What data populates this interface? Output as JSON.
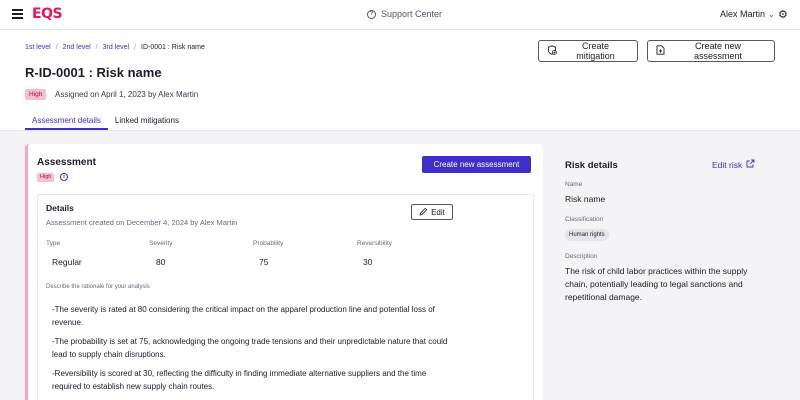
{
  "app": {
    "logo": "EQS",
    "support": "Support Center",
    "user": "Alex Martin"
  },
  "breadcrumb": [
    "1st level",
    "2nd level",
    "3rd level",
    "ID-0001 : Risk name"
  ],
  "header": {
    "title": "R-ID-0001 : Risk name",
    "badge": "High",
    "assigned": "Assigned on April 1, 2023 by Alex Martin",
    "create_mitigation": "Create mitigation",
    "create_new_assessment": "Create new assessment"
  },
  "tabs": [
    {
      "label": "Assessment details",
      "active": true
    },
    {
      "label": "Linked mitigations",
      "active": false
    }
  ],
  "assessment": {
    "title": "Assessment",
    "badge": "High",
    "button": "Create new assessment",
    "details": {
      "title": "Details",
      "meta": "Assessment created on December 4, 2024 by Alex Martin",
      "edit": "Edit",
      "fields": [
        {
          "label": "Type",
          "value": "Regular"
        },
        {
          "label": "Severity",
          "value": "80"
        },
        {
          "label": "Probability",
          "value": "75"
        },
        {
          "label": "Reversibility",
          "value": "30"
        }
      ],
      "rationale_label": "Describe the rationale for your analysis",
      "rationale": [
        "-The severity is rated at 80 considering the critical impact on the apparel production line and potential loss of revenue.",
        "-The probability is set at 75, acknowledging the ongoing trade tensions and their unpredictable nature that could lead to supply chain disruptions.",
        "-Reversibility is scored at 30, reflecting the difficulty in finding immediate alternative suppliers and the time required to establish new supply chain routes."
      ]
    }
  },
  "risk_details": {
    "title": "Risk details",
    "edit": "Edit risk",
    "name_label": "Name",
    "name": "Risk name",
    "classification_label": "Classification",
    "classification": "Human rights",
    "description_label": "Description",
    "description": "The risk of child labor practices within the supply chain, potentially leading to legal sanctions and repetitional damage."
  },
  "colors": {
    "accent": "#3e2fc9",
    "brand": "#e6175c",
    "high_badge_bg": "#f7bfcf"
  },
  "icons": {
    "menu": "menu-icon",
    "support": "help-circle-icon",
    "user_menu": "chevron-down-icon",
    "settings": "gear-icon",
    "mitigation": "shield-plus-icon",
    "assessment": "document-plus-icon",
    "info": "info-icon",
    "edit": "pencil-icon",
    "external": "external-link-icon"
  }
}
